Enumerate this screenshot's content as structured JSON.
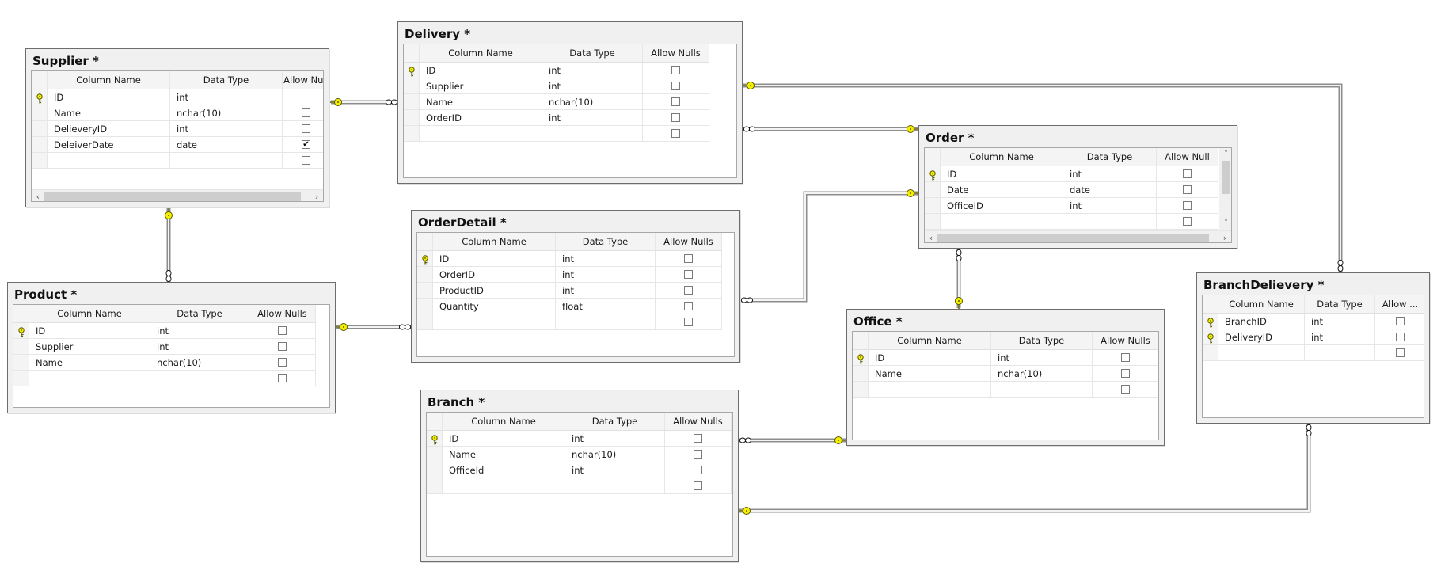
{
  "diagram": {
    "tables": [
      {
        "id": "supplier",
        "title": "Supplier *",
        "headers": {
          "column_name": "Column Name",
          "data_type": "Data Type",
          "allow_nulls": "Allow Null"
        },
        "rows": [
          {
            "name": "ID",
            "type": "int",
            "nullable": false,
            "pk": true
          },
          {
            "name": "Name",
            "type": "nchar(10)",
            "nullable": false,
            "pk": false
          },
          {
            "name": "DelieveryID",
            "type": "int",
            "nullable": false,
            "pk": false
          },
          {
            "name": "DeleiverDate",
            "type": "date",
            "nullable": true,
            "pk": false
          },
          {
            "name": "",
            "type": "",
            "nullable": false,
            "pk": false
          }
        ],
        "hscroll": true,
        "vscroll": false
      },
      {
        "id": "delivery",
        "title": "Delivery *",
        "headers": {
          "column_name": "Column Name",
          "data_type": "Data Type",
          "allow_nulls": "Allow Nulls"
        },
        "rows": [
          {
            "name": "ID",
            "type": "int",
            "nullable": false,
            "pk": true
          },
          {
            "name": "Supplier",
            "type": "int",
            "nullable": false,
            "pk": false
          },
          {
            "name": "Name",
            "type": "nchar(10)",
            "nullable": false,
            "pk": false
          },
          {
            "name": "OrderID",
            "type": "int",
            "nullable": false,
            "pk": false
          },
          {
            "name": "",
            "type": "",
            "nullable": false,
            "pk": false
          }
        ],
        "hscroll": false,
        "vscroll": false
      },
      {
        "id": "order",
        "title": "Order *",
        "headers": {
          "column_name": "Column Name",
          "data_type": "Data Type",
          "allow_nulls": "Allow Null"
        },
        "rows": [
          {
            "name": "ID",
            "type": "int",
            "nullable": false,
            "pk": true
          },
          {
            "name": "Date",
            "type": "date",
            "nullable": false,
            "pk": false
          },
          {
            "name": "OfficeID",
            "type": "int",
            "nullable": false,
            "pk": false
          },
          {
            "name": "",
            "type": "",
            "nullable": false,
            "pk": false
          }
        ],
        "hscroll": true,
        "vscroll": true
      },
      {
        "id": "orderdetail",
        "title": "OrderDetail *",
        "headers": {
          "column_name": "Column Name",
          "data_type": "Data Type",
          "allow_nulls": "Allow Nulls"
        },
        "rows": [
          {
            "name": "ID",
            "type": "int",
            "nullable": false,
            "pk": true
          },
          {
            "name": "OrderID",
            "type": "int",
            "nullable": false,
            "pk": false
          },
          {
            "name": "ProductID",
            "type": "int",
            "nullable": false,
            "pk": false
          },
          {
            "name": "Quantity",
            "type": "float",
            "nullable": false,
            "pk": false
          },
          {
            "name": "",
            "type": "",
            "nullable": false,
            "pk": false
          }
        ],
        "hscroll": false,
        "vscroll": false
      },
      {
        "id": "product",
        "title": "Product *",
        "headers": {
          "column_name": "Column Name",
          "data_type": "Data Type",
          "allow_nulls": "Allow Nulls"
        },
        "rows": [
          {
            "name": "ID",
            "type": "int",
            "nullable": false,
            "pk": true
          },
          {
            "name": "Supplier",
            "type": "int",
            "nullable": false,
            "pk": false
          },
          {
            "name": "Name",
            "type": "nchar(10)",
            "nullable": false,
            "pk": false
          },
          {
            "name": "",
            "type": "",
            "nullable": false,
            "pk": false
          }
        ],
        "hscroll": false,
        "vscroll": false
      },
      {
        "id": "office",
        "title": "Office *",
        "headers": {
          "column_name": "Column Name",
          "data_type": "Data Type",
          "allow_nulls": "Allow Nulls"
        },
        "rows": [
          {
            "name": "ID",
            "type": "int",
            "nullable": false,
            "pk": true
          },
          {
            "name": "Name",
            "type": "nchar(10)",
            "nullable": false,
            "pk": false
          },
          {
            "name": "",
            "type": "",
            "nullable": false,
            "pk": false
          }
        ],
        "hscroll": false,
        "vscroll": false
      },
      {
        "id": "branch",
        "title": "Branch *",
        "headers": {
          "column_name": "Column Name",
          "data_type": "Data Type",
          "allow_nulls": "Allow Nulls"
        },
        "rows": [
          {
            "name": "ID",
            "type": "int",
            "nullable": false,
            "pk": true
          },
          {
            "name": "Name",
            "type": "nchar(10)",
            "nullable": false,
            "pk": false
          },
          {
            "name": "OfficeId",
            "type": "int",
            "nullable": false,
            "pk": false
          },
          {
            "name": "",
            "type": "",
            "nullable": false,
            "pk": false
          }
        ],
        "hscroll": false,
        "vscroll": false
      },
      {
        "id": "branchdelievery",
        "title": "BranchDelievery *",
        "headers": {
          "column_name": "Column Name",
          "data_type": "Data Type",
          "allow_nulls": "Allow ..."
        },
        "rows": [
          {
            "name": "BranchID",
            "type": "int",
            "nullable": false,
            "pk": true
          },
          {
            "name": "DeliveryID",
            "type": "int",
            "nullable": false,
            "pk": true
          },
          {
            "name": "",
            "type": "",
            "nullable": false,
            "pk": false
          }
        ],
        "hscroll": false,
        "vscroll": false
      }
    ],
    "relationships": [
      {
        "id": "supplier-delivery",
        "one": "Supplier",
        "many": "Delivery"
      },
      {
        "id": "supplier-product",
        "one": "Supplier",
        "many": "Product"
      },
      {
        "id": "product-orderdetail",
        "one": "Product",
        "many": "OrderDetail"
      },
      {
        "id": "order-delivery",
        "one": "Order",
        "many": "Delivery"
      },
      {
        "id": "order-orderdetail",
        "one": "Order",
        "many": "OrderDetail"
      },
      {
        "id": "office-order",
        "one": "Office",
        "many": "Order"
      },
      {
        "id": "office-branch",
        "one": "Office",
        "many": "Branch"
      },
      {
        "id": "delivery-branchdelievery",
        "one": "Delivery",
        "many": "BranchDelievery"
      },
      {
        "id": "branch-branchdelievery",
        "one": "Branch",
        "many": "BranchDelievery"
      }
    ],
    "colors": {
      "key_yellow": "#f5f000",
      "connector_gray": "#8c8c8c",
      "table_bg": "#f0f0f0",
      "table_border": "#6d6d6d"
    }
  }
}
